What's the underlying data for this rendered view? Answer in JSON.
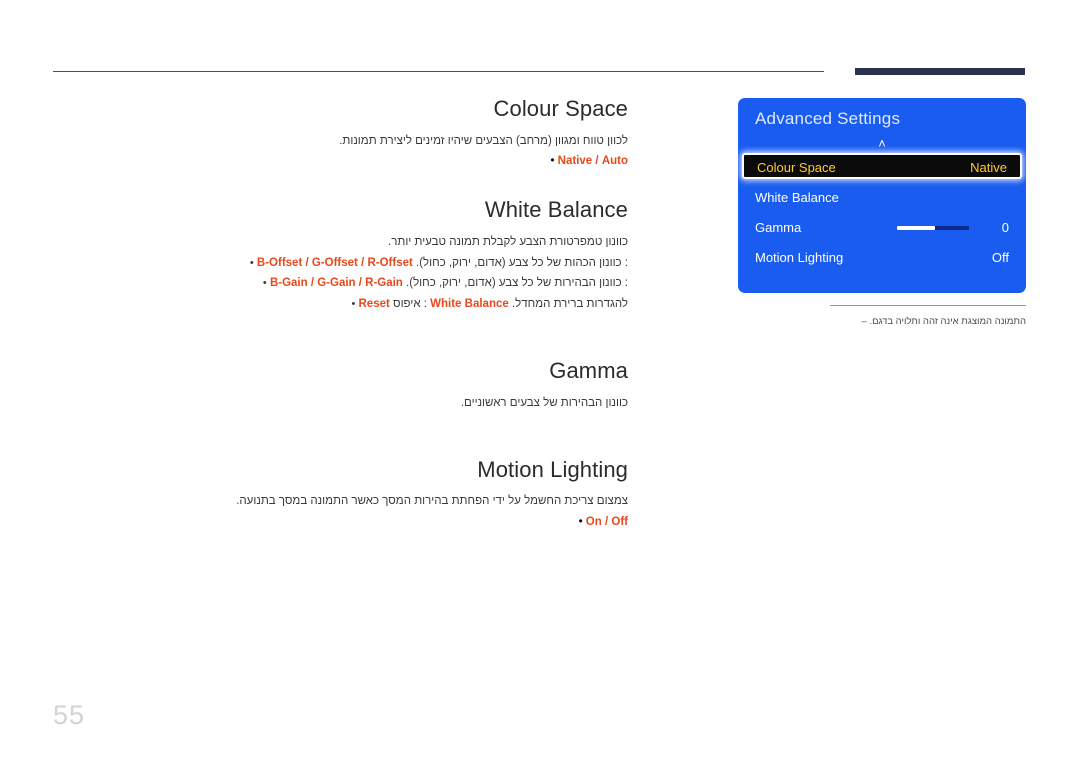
{
  "page": {
    "number": "55"
  },
  "sections": [
    {
      "key": "colour_space",
      "title": "Colour Space",
      "desc": "לכוון טווח ומגוון (מרחב) הצבעים שיהיו זמינים ליצירת תמונות.",
      "options": {
        "bullet": "•",
        "a": "Native",
        "sep": "/",
        "b": "Auto"
      }
    },
    {
      "key": "white_balance",
      "title": "White Balance",
      "desc": "כוונון טמפרטורת הצבע לקבלת תמונה טבעית יותר.",
      "bullets": [
        {
          "bullet": "•",
          "terms": "B-Offset / G-Offset / R-Offset",
          "text": ": כוונון הכהות של כל צבע (אדום, ירוק, כחול)."
        },
        {
          "bullet": "•",
          "terms": "B-Gain / G-Gain / R-Gain",
          "text": ": כוונון הבהירות של כל צבע (אדום, ירוק, כחול)."
        },
        {
          "bullet": "•",
          "terms": "Reset",
          "text": ": איפוס",
          "term2": "White Balance",
          "text2": "להגדרות ברירת המחדל."
        }
      ]
    },
    {
      "key": "gamma",
      "title": "Gamma",
      "desc": "כוונון הבהירות של צבעים ראשוניים."
    },
    {
      "key": "motion_lighting",
      "title": "Motion Lighting",
      "desc": "צמצום צריכת החשמל על ידי הפחתת בהירות המסך כאשר התמונה במסך בתנועה.",
      "options": {
        "bullet": "•",
        "a": "On",
        "sep": "/",
        "b": "Off"
      }
    }
  ],
  "osd": {
    "title": "Advanced Settings",
    "scroll_up_icon": "˄",
    "rows": [
      {
        "label": "Colour Space",
        "value": "Native",
        "selected": true
      },
      {
        "label": "White Balance",
        "value": "",
        "selected": false
      },
      {
        "label": "Gamma",
        "value": "0",
        "selected": false,
        "slider": true
      },
      {
        "label": "Motion Lighting",
        "value": "Off",
        "selected": false
      }
    ],
    "colors": {
      "panel_bg": "#1a5cf0",
      "selected_bg": "#0b0b0b",
      "selected_text": "#ffcb2e",
      "text": "#ffffff",
      "title_text": "#dfe9ff",
      "slider_fill": "#ffffff",
      "slider_track": "#0d2a8f"
    }
  },
  "caption": {
    "dash": "–",
    "text": "התמונה המוצגת אינה זהה ותלויה בדגם."
  },
  "theme": {
    "accent_red": "#e8491c",
    "rule_dark": "#2e3251",
    "rule_thin": "#4a4e6b",
    "page_number_color": "#d3d3d3"
  }
}
